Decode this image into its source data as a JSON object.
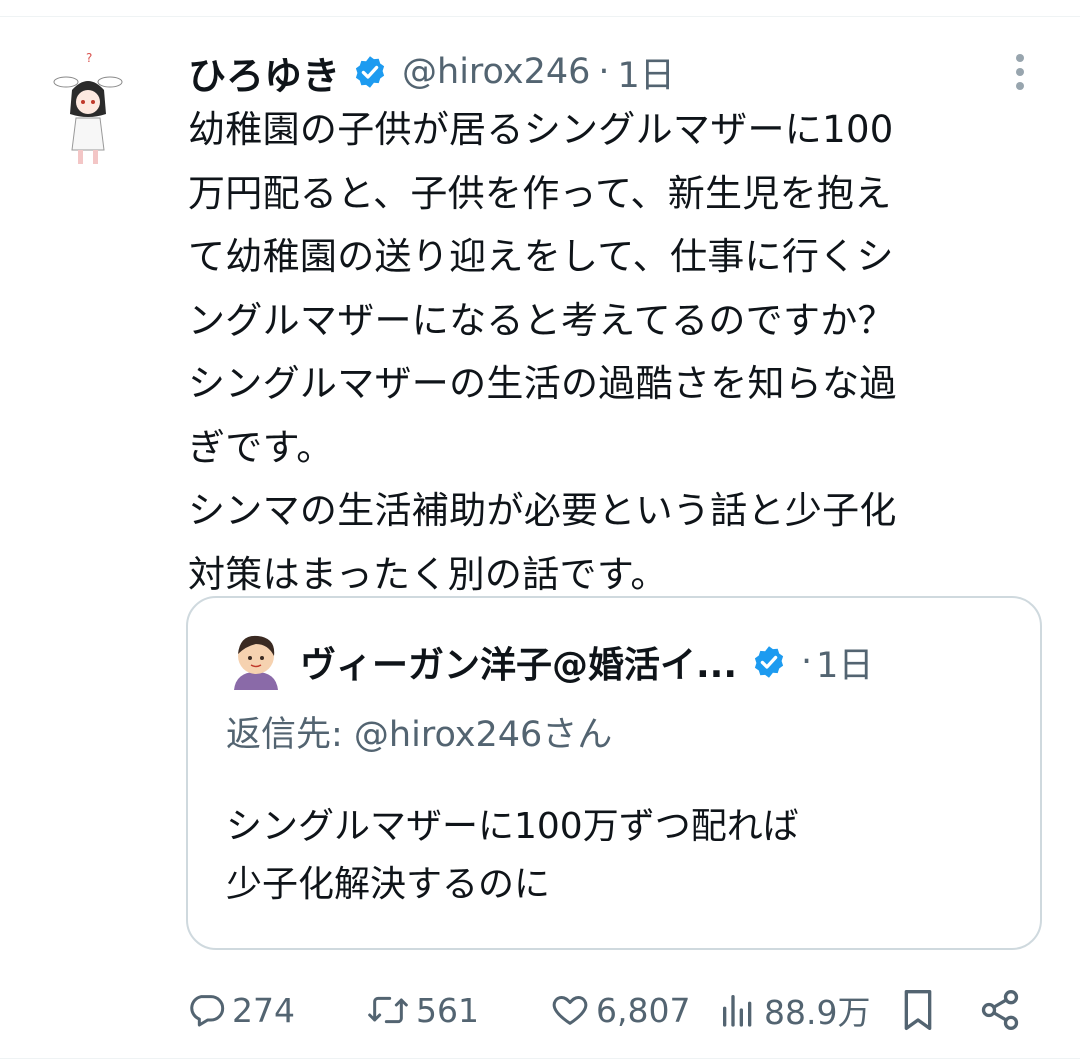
{
  "tweet": {
    "author_name": "ひろゆき",
    "author_handle": "@hirox246",
    "separator": "·",
    "time": "1日",
    "text": "幼稚園の子供が居るシングルマザーに100\n万円配ると、子供を作って、新生児を抱え\nて幼稚園の送り迎えをして、仕事に行くシ\nングルマザーになると考えてるのですか？\nシングルマザーの生活の過酷さを知らな過\nぎです。\nシンマの生活補助が必要という話と少子化\n対策はまったく別の話です。"
  },
  "quoted": {
    "author_name": "ヴィーガン洋子@婚活イ...",
    "separator": "·",
    "time": "1日",
    "reply_to": "返信先: @hirox246さん",
    "text": "シングルマザーに100万ずつ配れば\n少子化解決するのに"
  },
  "actions": {
    "replies": "274",
    "retweets": "561",
    "likes": "6,807",
    "views": "88.9万"
  },
  "icons": [
    "verified-badge-icon",
    "more-options-icon",
    "reply-icon",
    "retweet-icon",
    "like-icon",
    "views-icon",
    "bookmark-icon",
    "share-icon"
  ],
  "colors": {
    "verified": "#1d9bf0",
    "secondary_text": "#536471",
    "border": "#cfd9de"
  }
}
